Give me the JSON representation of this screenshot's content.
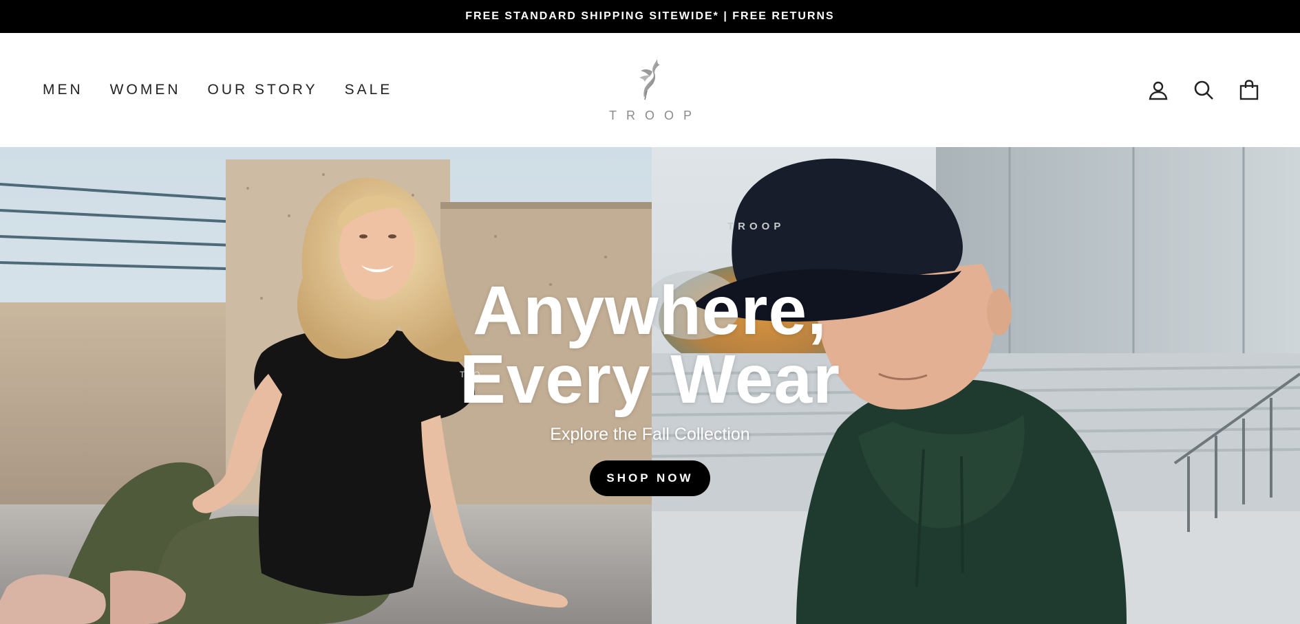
{
  "announcement": {
    "text": "FREE STANDARD SHIPPING SITEWIDE* | FREE RETURNS"
  },
  "header": {
    "nav": [
      {
        "label": "MEN"
      },
      {
        "label": "WOMEN"
      },
      {
        "label": "OUR STORY"
      },
      {
        "label": "SALE"
      }
    ],
    "logo_text": "TROOP",
    "icons": [
      "account-icon",
      "search-icon",
      "cart-icon"
    ]
  },
  "hero": {
    "title_line1": "Anywhere,",
    "title_line2": "Every Wear",
    "subtitle": "Explore the Fall Collection",
    "cta_label": "SHOP NOW",
    "cap_logo_text": "TROOP",
    "shirt_logo_text": "TRO"
  },
  "colors": {
    "announcement_bg": "#000000",
    "header_bg": "#ffffff",
    "nav_text": "#222222",
    "logo_gray": "#8a8a8a",
    "cta_bg": "#000000",
    "cta_text": "#ffffff"
  }
}
